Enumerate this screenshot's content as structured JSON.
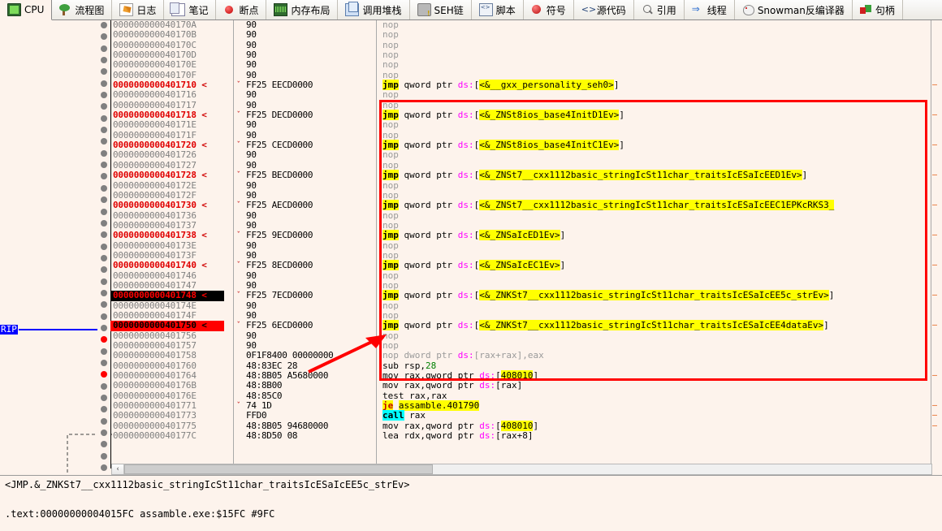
{
  "toolbar": {
    "tabs": [
      {
        "label": "CPU",
        "icon": "cpu-icon",
        "active": true
      },
      {
        "label": "流程图",
        "icon": "tree-icon",
        "active": false
      },
      {
        "label": "日志",
        "icon": "document-pencil-icon",
        "active": false
      },
      {
        "label": "笔记",
        "icon": "notes-icon",
        "active": false
      },
      {
        "label": "断点",
        "icon": "breakpoint-dot-icon",
        "active": false
      },
      {
        "label": "内存布局",
        "icon": "memory-icon",
        "active": false
      },
      {
        "label": "调用堆栈",
        "icon": "call-stack-icon",
        "active": false
      },
      {
        "label": "SEH链",
        "icon": "seh-chain-icon",
        "active": false
      },
      {
        "label": "脚本",
        "icon": "script-icon",
        "active": false
      },
      {
        "label": "符号",
        "icon": "symbol-icon",
        "active": false
      },
      {
        "label": "源代码",
        "icon": "source-code-icon",
        "active": false
      },
      {
        "label": "引用",
        "icon": "search-reference-icon",
        "active": false
      },
      {
        "label": "线程",
        "icon": "threads-icon",
        "active": false
      },
      {
        "label": "Snowman反编译器",
        "icon": "snowman-icon",
        "active": false
      },
      {
        "label": "句柄",
        "icon": "handles-icon",
        "active": false
      }
    ]
  },
  "markers": {
    "rip_label": "RIP"
  },
  "disassembly": {
    "rows": [
      {
        "addr": "000000000040170A",
        "hex": "90",
        "dis": "nop",
        "kind": "nop",
        "jmp": false,
        "chev": false
      },
      {
        "addr": "000000000040170B",
        "hex": "90",
        "dis": "nop",
        "kind": "nop",
        "jmp": false,
        "chev": false
      },
      {
        "addr": "000000000040170C",
        "hex": "90",
        "dis": "nop",
        "kind": "nop",
        "jmp": false,
        "chev": false
      },
      {
        "addr": "000000000040170D",
        "hex": "90",
        "dis": "nop",
        "kind": "nop",
        "jmp": false,
        "chev": false
      },
      {
        "addr": "000000000040170E",
        "hex": "90",
        "dis": "nop",
        "kind": "nop",
        "jmp": false,
        "chev": false
      },
      {
        "addr": "000000000040170F",
        "hex": "90",
        "dis": "nop",
        "kind": "nop",
        "jmp": false,
        "chev": false
      },
      {
        "addr": "0000000000401710",
        "hex": "FF25 EECD0000",
        "dis": "jmp qword ptr ds:[<&__gxx_personality_seh0>]",
        "kind": "jmp",
        "jmp": true,
        "chev": true,
        "sym": "<&__gxx_personality_seh0>"
      },
      {
        "addr": "0000000000401716",
        "hex": "90",
        "dis": "nop",
        "kind": "nop",
        "jmp": false,
        "chev": false
      },
      {
        "addr": "0000000000401717",
        "hex": "90",
        "dis": "nop",
        "kind": "nop",
        "jmp": false,
        "chev": false
      },
      {
        "addr": "0000000000401718",
        "hex": "FF25 DECD0000",
        "dis": "jmp qword ptr ds:[<&_ZNSt8ios_base4InitD1Ev>]",
        "kind": "jmp",
        "jmp": true,
        "chev": true,
        "sym": "<&_ZNSt8ios_base4InitD1Ev>"
      },
      {
        "addr": "000000000040171E",
        "hex": "90",
        "dis": "nop",
        "kind": "nop",
        "jmp": false,
        "chev": false
      },
      {
        "addr": "000000000040171F",
        "hex": "90",
        "dis": "nop",
        "kind": "nop",
        "jmp": false,
        "chev": false
      },
      {
        "addr": "0000000000401720",
        "hex": "FF25 CECD0000",
        "dis": "jmp qword ptr ds:[<&_ZNSt8ios_base4InitC1Ev>]",
        "kind": "jmp",
        "jmp": true,
        "chev": true,
        "sym": "<&_ZNSt8ios_base4InitC1Ev>"
      },
      {
        "addr": "0000000000401726",
        "hex": "90",
        "dis": "nop",
        "kind": "nop",
        "jmp": false,
        "chev": false
      },
      {
        "addr": "0000000000401727",
        "hex": "90",
        "dis": "nop",
        "kind": "nop",
        "jmp": false,
        "chev": false
      },
      {
        "addr": "0000000000401728",
        "hex": "FF25 BECD0000",
        "dis": "jmp qword ptr ds:[<&_ZNSt7__cxx1112basic_stringIcSt11char_traitsIcESaIcEED1Ev>]",
        "kind": "jmp",
        "jmp": true,
        "chev": true,
        "sym": "<&_ZNSt7__cxx1112basic_stringIcSt11char_traitsIcESaIcEED1Ev>"
      },
      {
        "addr": "000000000040172E",
        "hex": "90",
        "dis": "nop",
        "kind": "nop",
        "jmp": false,
        "chev": false
      },
      {
        "addr": "000000000040172F",
        "hex": "90",
        "dis": "nop",
        "kind": "nop",
        "jmp": false,
        "chev": false
      },
      {
        "addr": "0000000000401730",
        "hex": "FF25 AECD0000",
        "dis": "jmp qword ptr ds:[<&_ZNSt7__cxx1112basic_stringIcSt11char_traitsIcESaIcEEC1EPKcRKS3_",
        "kind": "jmp",
        "jmp": true,
        "chev": true,
        "sym": "<&_ZNSt7__cxx1112basic_stringIcSt11char_traitsIcESaIcEEC1EPKcRKS3_"
      },
      {
        "addr": "0000000000401736",
        "hex": "90",
        "dis": "nop",
        "kind": "nop",
        "jmp": false,
        "chev": false
      },
      {
        "addr": "0000000000401737",
        "hex": "90",
        "dis": "nop",
        "kind": "nop",
        "jmp": false,
        "chev": false
      },
      {
        "addr": "0000000000401738",
        "hex": "FF25 9ECD0000",
        "dis": "jmp qword ptr ds:[<&_ZNSaIcED1Ev>]",
        "kind": "jmp",
        "jmp": true,
        "chev": true,
        "sym": "<&_ZNSaIcED1Ev>"
      },
      {
        "addr": "000000000040173E",
        "hex": "90",
        "dis": "nop",
        "kind": "nop",
        "jmp": false,
        "chev": false
      },
      {
        "addr": "000000000040173F",
        "hex": "90",
        "dis": "nop",
        "kind": "nop",
        "jmp": false,
        "chev": false
      },
      {
        "addr": "0000000000401740",
        "hex": "FF25 8ECD0000",
        "dis": "jmp qword ptr ds:[<&_ZNSaIcEC1Ev>]",
        "kind": "jmp",
        "jmp": true,
        "chev": true,
        "sym": "<&_ZNSaIcEC1Ev>"
      },
      {
        "addr": "0000000000401746",
        "hex": "90",
        "dis": "nop",
        "kind": "nop",
        "jmp": false,
        "chev": false
      },
      {
        "addr": "0000000000401747",
        "hex": "90",
        "dis": "nop",
        "kind": "nop",
        "jmp": false,
        "chev": false
      },
      {
        "addr": "0000000000401748",
        "hex": "FF25 7ECD0000",
        "dis": "jmp qword ptr ds:[<&_ZNKSt7__cxx1112basic_stringIcSt11char_traitsIcESaIcEE5c_strEv>]",
        "kind": "jmp",
        "jmp": true,
        "chev": true,
        "sym": "<&_ZNKSt7__cxx1112basic_stringIcSt11char_traitsIcESaIcEE5c_strEv>",
        "state": "selected",
        "bp": "red"
      },
      {
        "addr": "000000000040174E",
        "hex": "90",
        "dis": "nop",
        "kind": "nop",
        "jmp": false,
        "chev": false
      },
      {
        "addr": "000000000040174F",
        "hex": "90",
        "dis": "nop",
        "kind": "nop",
        "jmp": false,
        "chev": false
      },
      {
        "addr": "0000000000401750",
        "hex": "FF25 6ECD0000",
        "dis": "jmp qword ptr ds:[<&_ZNKSt7__cxx1112basic_stringIcSt11char_traitsIcESaIcEE4dataEv>]",
        "kind": "jmp",
        "jmp": true,
        "chev": true,
        "sym": "<&_ZNKSt7__cxx1112basic_stringIcSt11char_traitsIcESaIcEE4dataEv>",
        "state": "bpsel",
        "bp": "red"
      },
      {
        "addr": "0000000000401756",
        "hex": "90",
        "dis": "nop",
        "kind": "nop",
        "jmp": false,
        "chev": false
      },
      {
        "addr": "0000000000401757",
        "hex": "90",
        "dis": "nop",
        "kind": "nop",
        "jmp": false,
        "chev": false
      },
      {
        "addr": "0000000000401758",
        "hex": "0F1F8400 00000000",
        "dis": "nop dword ptr ds:[rax+rax],eax",
        "kind": "nopmem",
        "jmp": false,
        "chev": false
      },
      {
        "addr": "0000000000401760",
        "hex": "48:83EC 28",
        "dis": "sub rsp,28",
        "kind": "sub",
        "jmp": false,
        "chev": false,
        "imm": "28"
      },
      {
        "addr": "0000000000401764",
        "hex": "48:8B05 A5680000",
        "dis": "mov rax,qword ptr ds:[408010]",
        "kind": "movmem",
        "jmp": false,
        "chev": false,
        "tgt": "408010"
      },
      {
        "addr": "000000000040176B",
        "hex": "48:8B00",
        "dis": "mov rax,qword ptr ds:[rax]",
        "kind": "movreg",
        "jmp": false,
        "chev": false
      },
      {
        "addr": "000000000040176E",
        "hex": "48:85C0",
        "dis": "test rax,rax",
        "kind": "test",
        "jmp": false,
        "chev": false
      },
      {
        "addr": "0000000000401771",
        "hex": "74 1D",
        "dis": "je assamble.401790",
        "kind": "je",
        "jmp": false,
        "chev": true,
        "tgt": "assamble.401790"
      },
      {
        "addr": "0000000000401773",
        "hex": "FFD0",
        "dis": "call rax",
        "kind": "call",
        "jmp": false,
        "chev": false
      },
      {
        "addr": "0000000000401775",
        "hex": "48:8B05 94680000",
        "dis": "mov rax,qword ptr ds:[408010]",
        "kind": "movmem",
        "jmp": false,
        "chev": false,
        "tgt": "408010"
      },
      {
        "addr": "000000000040177C",
        "hex": "48:8D50 08",
        "dis": "lea rdx,qword ptr ds:[rax+8]",
        "kind": "lea",
        "jmp": false,
        "chev": false
      }
    ]
  },
  "status": {
    "line1": "<JMP.&_ZNKSt7__cxx1112basic_stringIcSt11char_traitsIcESaIcEE5c_strEv>",
    "line2": ".text:00000000004015FC  assamble.exe:$15FC #9FC"
  },
  "colors": {
    "annotation_red": "#ff0000",
    "symbol_highlight": "#ffff00",
    "call_highlight": "#00ffff",
    "jump_address": "#e00000",
    "ds_prefix": "#ff00ff",
    "rip_marker_bg": "#0000ff"
  },
  "scrollbar": {
    "left_arrow": "‹"
  }
}
